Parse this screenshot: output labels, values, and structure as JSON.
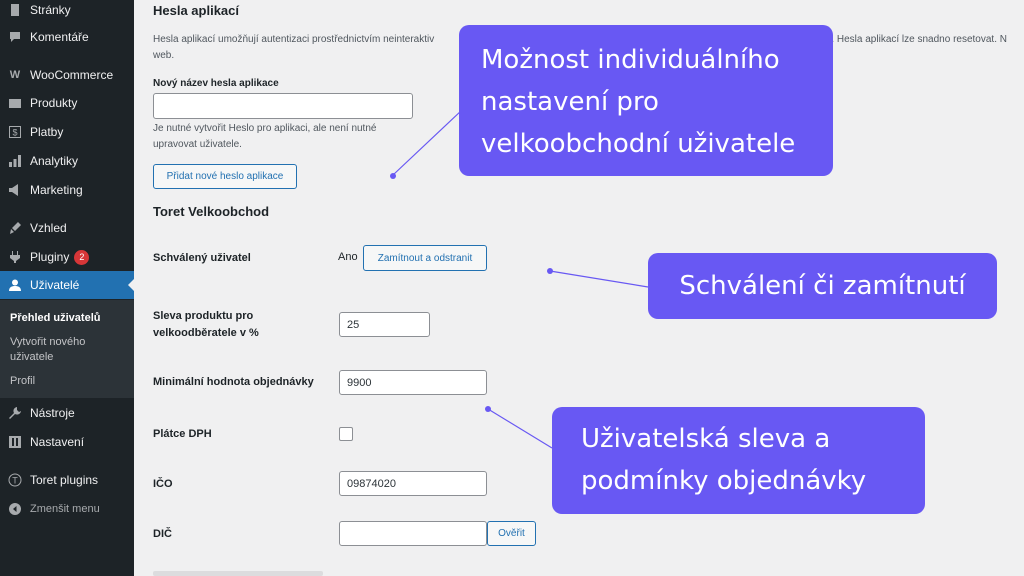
{
  "colors": {
    "accent": "#2271b1",
    "sidebar_bg": "#1d2327",
    "callout_bg": "#6858f3",
    "badge": "#d63638"
  },
  "sidebar": {
    "items": [
      {
        "label": "Stránky",
        "icon": "pages-icon"
      },
      {
        "label": "Komentáře",
        "icon": "comments-icon"
      },
      {
        "label": "WooCommerce",
        "icon": "woocommerce-icon"
      },
      {
        "label": "Produkty",
        "icon": "products-icon"
      },
      {
        "label": "Platby",
        "icon": "payments-icon"
      },
      {
        "label": "Analytiky",
        "icon": "analytics-icon"
      },
      {
        "label": "Marketing",
        "icon": "marketing-icon"
      },
      {
        "label": "Vzhled",
        "icon": "appearance-icon"
      },
      {
        "label": "Pluginy",
        "icon": "plugins-icon",
        "badge": "2"
      },
      {
        "label": "Uživatelé",
        "icon": "users-icon"
      },
      {
        "label": "Nástroje",
        "icon": "tools-icon"
      },
      {
        "label": "Nastavení",
        "icon": "settings-icon"
      },
      {
        "label": "Toret plugins",
        "icon": "toret-icon"
      },
      {
        "label": "Zmenšit menu",
        "icon": "collapse-icon"
      }
    ],
    "submenu": [
      "Přehled uživatelů",
      "Vytvořit nového uživatele",
      "Profil"
    ]
  },
  "app_passwords": {
    "title": "Hesla aplikací",
    "description_line1": "Hesla aplikací umožňují autentizaci prostřednictvím neinteraktiv",
    "description_right": "ole. Hesla aplikací lze snadno resetovat. N",
    "description_line2": "web.",
    "new_name_label": "Nový název hesla aplikace",
    "new_name_value": "",
    "help_text": "Je nutné vytvořit Heslo pro aplikaci, ale není nutné upravovat uživatele.",
    "add_button": "Přidat nové heslo aplikace"
  },
  "toret": {
    "title": "Toret Velkoobchod",
    "approved_label": "Schválený uživatel",
    "approved_value": "Ano",
    "reject_button": "Zamítnout a odstranit",
    "discount_label": "Sleva produktu pro velkoodběratele v %",
    "discount_value": "25",
    "min_order_label": "Minimální hodnota objednávky",
    "min_order_value": "9900",
    "vat_label": "Plátce DPH",
    "vat_checked": false,
    "ico_label": "IČO",
    "ico_value": "09874020",
    "dic_label": "DIČ",
    "dic_value": "",
    "verify_button": "Ověřit"
  },
  "callouts": {
    "individual": "Možnost individuálního nastavení pro velkoobchodní uživatele",
    "approval": "Schválení či zamítnutí",
    "discount": "Uživatelská sleva a podmínky objednávky"
  }
}
